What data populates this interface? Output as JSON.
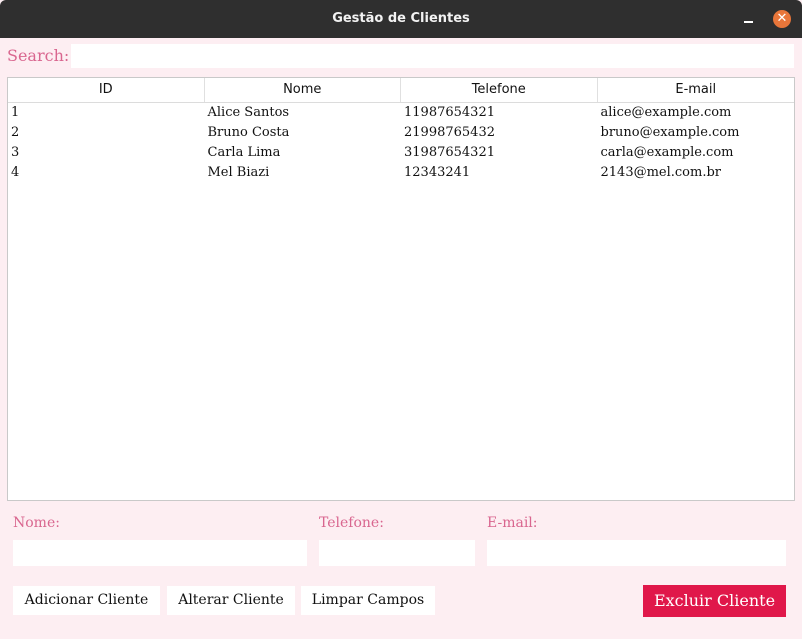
{
  "window": {
    "title": "Gestão de Clientes",
    "minimize_glyph": "",
    "close_glyph": "✕"
  },
  "search": {
    "label": "Search:",
    "value": "",
    "placeholder": ""
  },
  "table": {
    "columns": [
      "ID",
      "Nome",
      "Telefone",
      "E-mail"
    ],
    "rows": [
      [
        "1",
        "Alice Santos",
        "11987654321",
        "alice@example.com"
      ],
      [
        "2",
        "Bruno Costa",
        "21998765432",
        "bruno@example.com"
      ],
      [
        "3",
        "Carla Lima",
        "31987654321",
        "carla@example.com"
      ],
      [
        "4",
        "Mel Biazi",
        "12343241",
        "2143@mel.com.br"
      ]
    ]
  },
  "form": {
    "nome_label": "Nome:",
    "nome_value": "",
    "telefone_label": "Telefone:",
    "telefone_value": "",
    "email_label": "E-mail:",
    "email_value": ""
  },
  "buttons": {
    "add": "Adicionar Cliente",
    "edit": "Alterar Cliente",
    "clear": "Limpar Campos",
    "delete": "Excluir Cliente"
  },
  "colors": {
    "background": "#fdeef2",
    "accent_text": "#d9668f",
    "danger": "#e0174a",
    "titlebar": "#2f2f2f",
    "close_button": "#e8763a"
  }
}
